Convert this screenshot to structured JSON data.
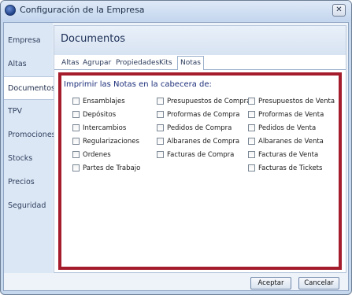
{
  "window": {
    "title": "Configuración de la Empresa",
    "close_glyph": "✕"
  },
  "sidebar": {
    "items": [
      {
        "label": "Empresa"
      },
      {
        "label": "Altas"
      },
      {
        "label": "Documentos",
        "active": true
      },
      {
        "label": "TPV"
      },
      {
        "label": "Promociones"
      },
      {
        "label": "Stocks"
      },
      {
        "label": "Precios"
      },
      {
        "label": "Seguridad"
      }
    ]
  },
  "main": {
    "title": "Documentos",
    "tabs": [
      {
        "label": "Altas"
      },
      {
        "label": "Agrupar"
      },
      {
        "label": "Propiedades"
      },
      {
        "label": "Kits"
      },
      {
        "label": "Notas",
        "active": true
      }
    ],
    "panel": {
      "heading": "Imprimir las Notas en la cabecera de:",
      "columns": [
        [
          "Ensamblajes",
          "Depósitos",
          "Intercambios",
          "Regularizaciones",
          "Ordenes",
          "Partes de Trabajo"
        ],
        [
          "Presupuestos de Compra",
          "Proformas de Compra",
          "Pedidos de Compra",
          "Albaranes de Compra",
          "Facturas de Compra"
        ],
        [
          "Presupuestos de Venta",
          "Proformas de Venta",
          "Pedidos de Venta",
          "Albaranes de Venta",
          "Facturas de Venta",
          "Facturas de Tickets"
        ]
      ]
    }
  },
  "footer": {
    "accept_label": "Aceptar",
    "cancel_label": "Cancelar"
  },
  "colors": {
    "highlight_border": "#a51d2d",
    "accent": "#1c2e7a"
  }
}
